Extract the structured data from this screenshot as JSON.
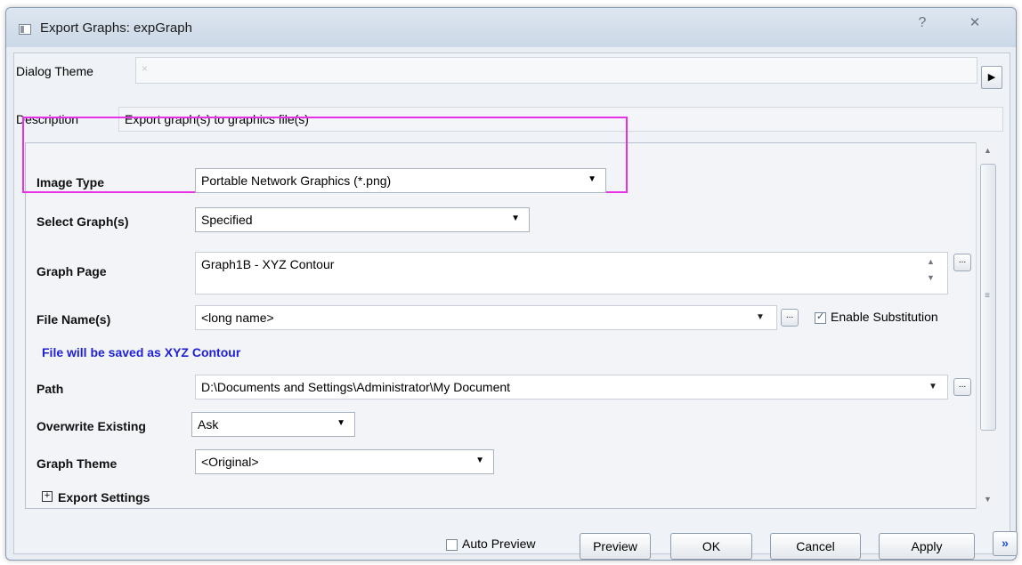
{
  "window": {
    "title": "Export Graphs: expGraph",
    "help_glyph": "?",
    "close_glyph": "✕"
  },
  "theme": {
    "label": "Dialog Theme",
    "value_glyph": "×"
  },
  "description": {
    "label": "Description",
    "text": "Export graph(s) to graphics file(s)"
  },
  "fields": {
    "image_type": {
      "label": "Image Type",
      "value": "Portable Network Graphics (*.png)"
    },
    "select_graphs": {
      "label": "Select Graph(s)",
      "value": "Specified"
    },
    "graph_page": {
      "label": "Graph Page",
      "value": "Graph1B - XYZ Contour"
    },
    "file_names": {
      "label": "File Name(s)",
      "value": "<long name>",
      "enable_substitution_label": "Enable Substitution",
      "enable_substitution_checked": true
    },
    "notice": "File will be saved as XYZ Contour",
    "path": {
      "label": "Path",
      "value": "D:\\Documents and Settings\\Administrator\\My Document"
    },
    "overwrite_existing": {
      "label": "Overwrite Existing",
      "value": "Ask"
    },
    "graph_theme": {
      "label": "Graph Theme",
      "value": "<Original>"
    },
    "export_settings": {
      "label": "Export Settings",
      "expander_glyph": "+"
    }
  },
  "footer": {
    "auto_preview_label": "Auto Preview",
    "auto_preview_checked": false,
    "preview_label": "Preview",
    "ok_label": "OK",
    "cancel_label": "Cancel",
    "apply_label": "Apply",
    "more_glyph": "»"
  },
  "glyphs": {
    "caret": "▼",
    "ellipsis": "...",
    "spin_up": "▲",
    "spin_down": "▼",
    "scroll_up": "▲",
    "scroll_down": "▼",
    "grip": "≡",
    "arrow_right": "▶"
  },
  "colors": {
    "highlight_border": "#e631e6",
    "notice_text": "#1f1fd6",
    "window_background": "#eff2f6"
  }
}
